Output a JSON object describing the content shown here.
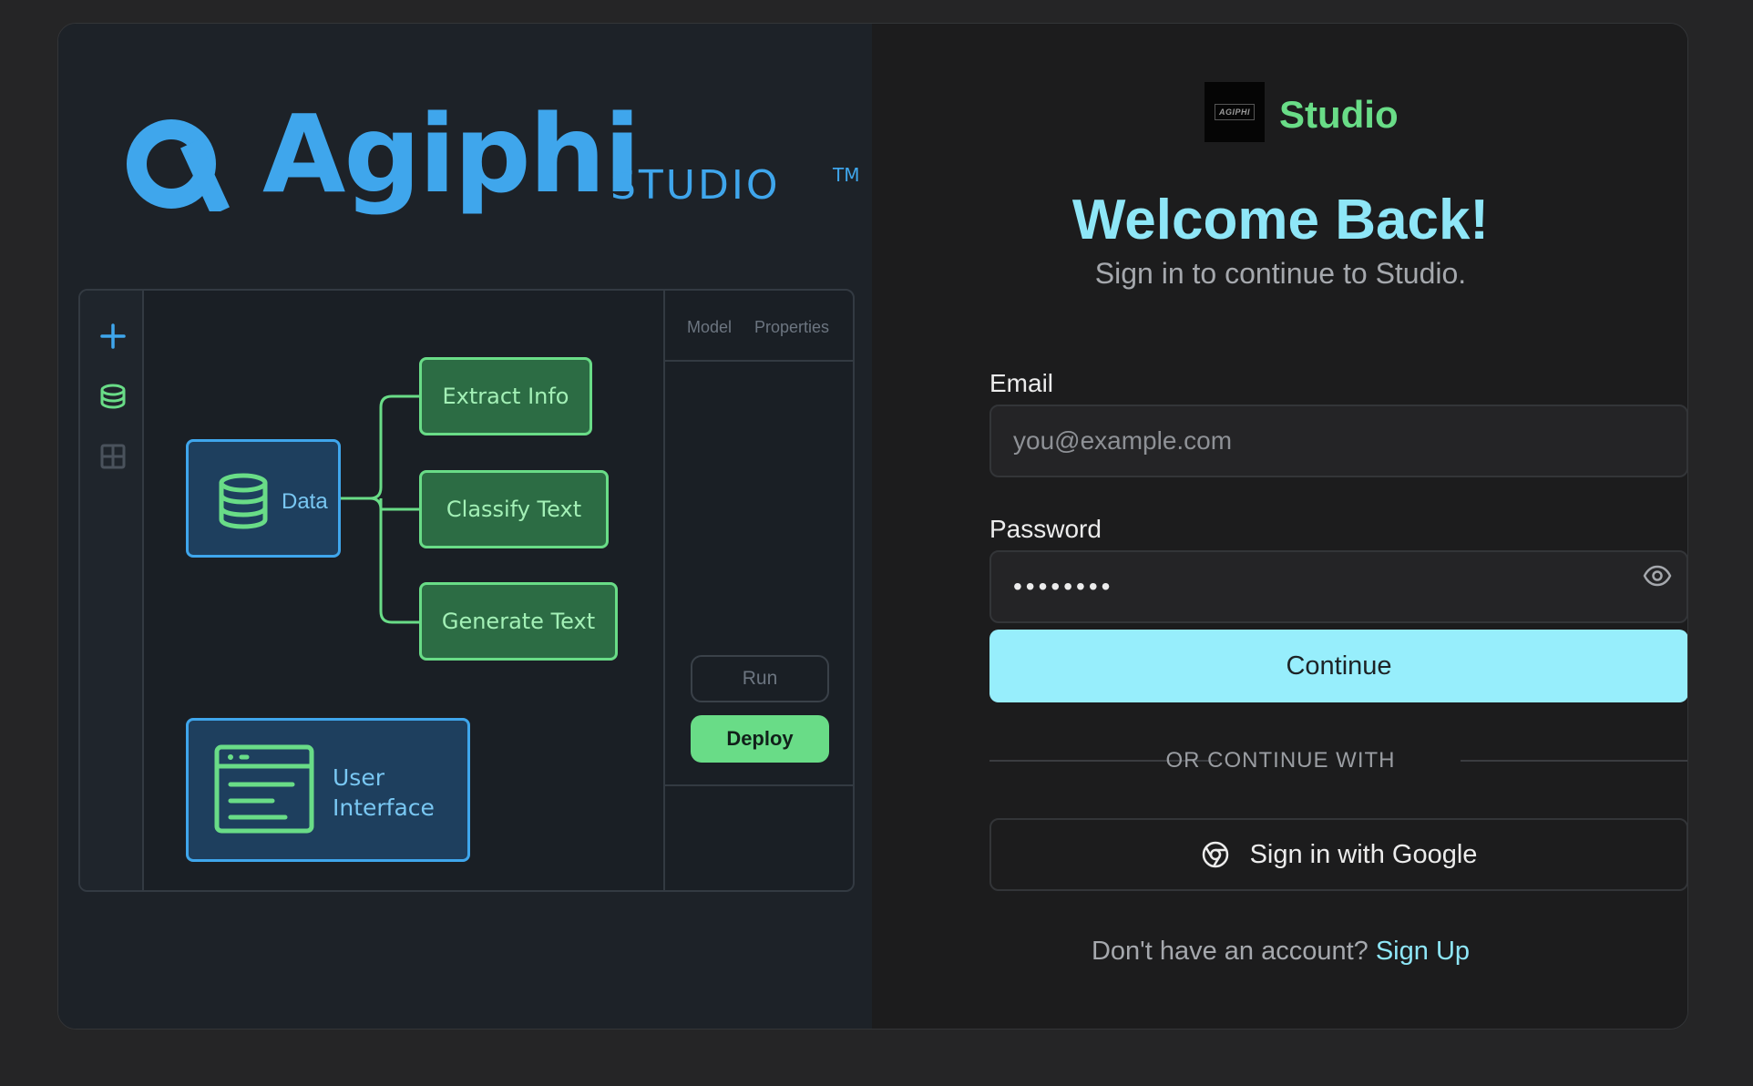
{
  "left": {
    "logo": {
      "word": "Agiphi",
      "sub": "STUDIO",
      "tm": "TM"
    },
    "editor": {
      "rail_icons": [
        "plus-icon",
        "database-icon",
        "grid-icon"
      ],
      "panel_tabs": [
        "Model",
        "Properties"
      ],
      "run_label": "Run",
      "deploy_label": "Deploy",
      "nodes": {
        "data": "Data",
        "extract": "Extract Info",
        "classify": "Classify Text",
        "generate": "Generate Text",
        "ui_line1": "User",
        "ui_line2": "Interface"
      }
    }
  },
  "right": {
    "brand": {
      "logo_text": "AGIPHI",
      "name": "Studio"
    },
    "welcome": "Welcome Back!",
    "subtitle": "Sign in to continue to Studio.",
    "email": {
      "label": "Email",
      "placeholder": "you@example.com",
      "value": ""
    },
    "password": {
      "label": "Password",
      "value": "••••••••"
    },
    "continue_label": "Continue",
    "divider": "OR CONTINUE WITH",
    "google_label": "Sign in with Google",
    "signup_prompt": "Don't have an account?",
    "signup_link": "Sign Up"
  },
  "colors": {
    "accent_cyan": "#97eefc",
    "brand_green": "#69dc87",
    "brand_blue": "#3fa6ec"
  }
}
